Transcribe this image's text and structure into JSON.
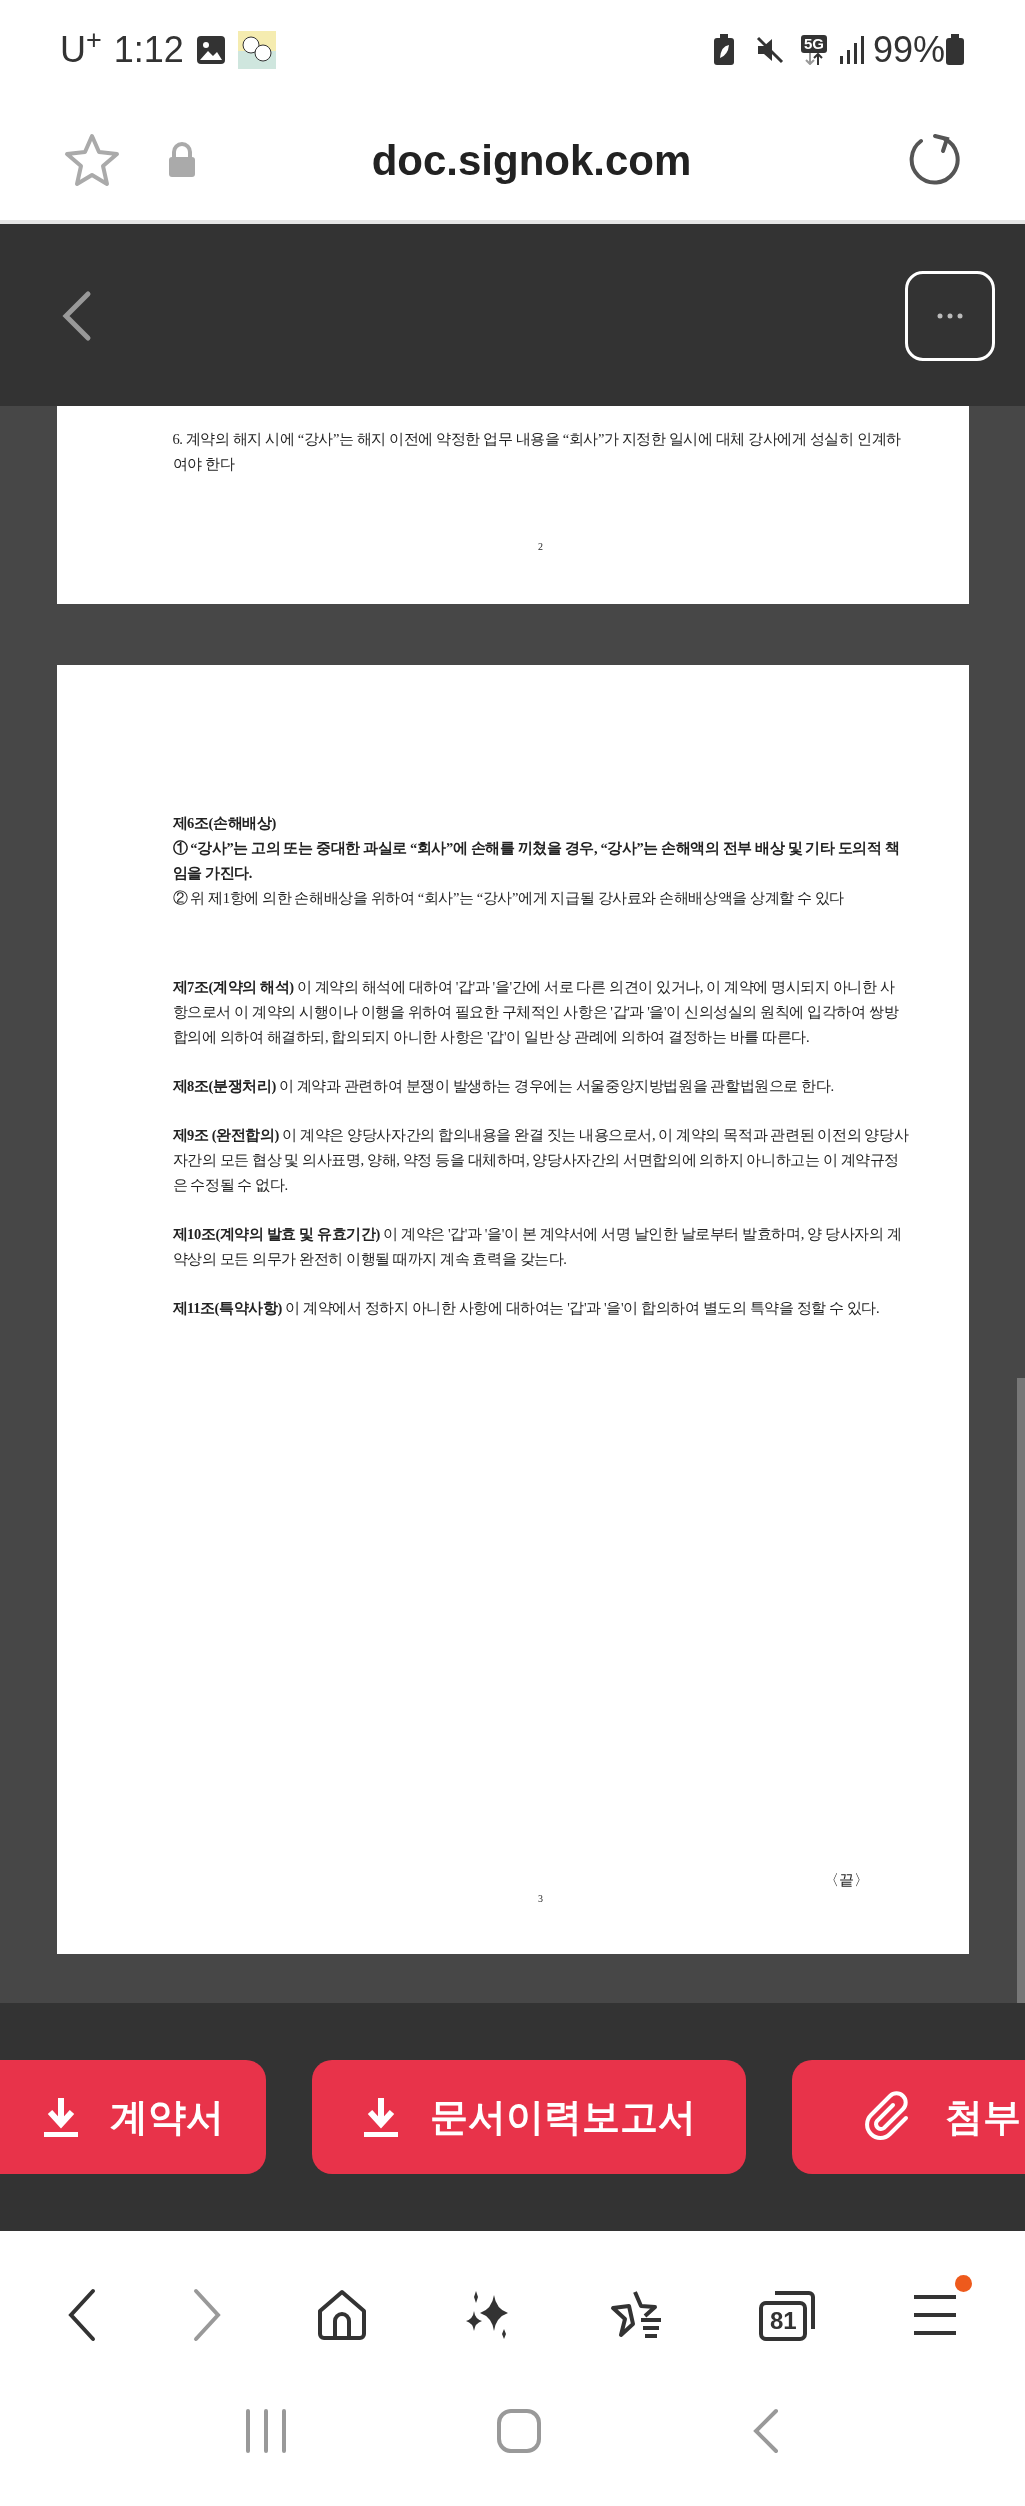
{
  "status_bar": {
    "carrier": "U$^{+}$",
    "time": "1:12",
    "network": "5G",
    "battery": "99%"
  },
  "browser": {
    "url": "doc.signok.com"
  },
  "pages": [
    {
      "paragraphs": [
        {
          "kind": "text",
          "text": "6.  계약의 해지 시에 “강사”는 해지 이전에 약정한 업무 내용을 “회사”가 지정한 일시에 대체 강사에게 성실히 인계하여야 한다"
        }
      ],
      "page_number": "2"
    },
    {
      "sections": [
        {
          "paragraphs": [
            {
              "kind": "bold",
              "text": "제6조(손해배상)"
            },
            {
              "kind": "bold",
              "text": "① “강사”는 고의 또는 중대한 과실로 “회사”에 손해를 끼쳤을 경우, “강사”는 손해액의 전부 배상 및 기타 도의적 책임을 가진다."
            },
            {
              "kind": "text",
              "text": "② 위 제1항에 의한 손해배상을 위하여 “회사”는 “강사”에게 지급될 강사료와 손해배상액을 상계할 수 있다"
            }
          ]
        },
        {
          "paragraphs": [
            {
              "kind": "text",
              "text": "**제7조(계약의 해석)** 이 계약의 해석에 대하여 '갑'과 '을'간에 서로 다른 의견이 있거나, 이 계약에 명시되지 아니한 사항으로서 이 계약의 시행이나 이행을 위하여 필요한 구체적인 사항은 '갑'과 '을'이 신의성실의 원칙에 입각하여 쌍방합의에 의하여 해결하되, 합의되지 아니한 사항은 '갑'이 일반 상 관례에 의하여 결정하는 바를 따른다."
            }
          ]
        },
        {
          "paragraphs": [
            {
              "kind": "text",
              "text": "**제8조(분쟁처리)** 이 계약과 관련하여 분쟁이 발생하는 경우에는 서울중앙지방법원을 관할법원으로 한다."
            }
          ]
        },
        {
          "paragraphs": [
            {
              "kind": "text",
              "text": "**제9조 (완전합의)** 이 계약은 양당사자간의 합의내용을 완결 짓는 내용으로서, 이 계약의 목적과 관련된 이전의 양당사자간의 모든 협상 및 의사표명, 양해, 약정 등을 대체하며, 양당사자간의 서면합의에 의하지 아니하고는 이 계약규정은 수정될 수 없다."
            }
          ]
        },
        {
          "paragraphs": [
            {
              "kind": "text",
              "text": "**제10조(계약의 발효 및 유효기간)** 이 계약은 '갑'과 '을'이 본 계약서에 서명 날인한 날로부터 발효하며, 양 당사자의 계약상의 모든 의무가 완전히 이행될 때까지 계속 효력을 갖는다."
            }
          ]
        },
        {
          "paragraphs": [
            {
              "kind": "text",
              "text": "**제11조(특약사항)** 이 계약에서 정하지 아니한 사항에 대하여는 '갑'과 '을'이 합의하여 별도의 특약을 정할 수 있다."
            }
          ]
        }
      ],
      "end_mark": "〈끝〉",
      "page_number": "3"
    }
  ],
  "action_buttons": [
    {
      "kind": "download",
      "label": "계약서"
    },
    {
      "kind": "download",
      "label": "문서이력보고서"
    },
    {
      "kind": "attach",
      "label": "첨부"
    }
  ],
  "toolbar": {
    "tab_count": "81",
    "menu_notification": true
  }
}
